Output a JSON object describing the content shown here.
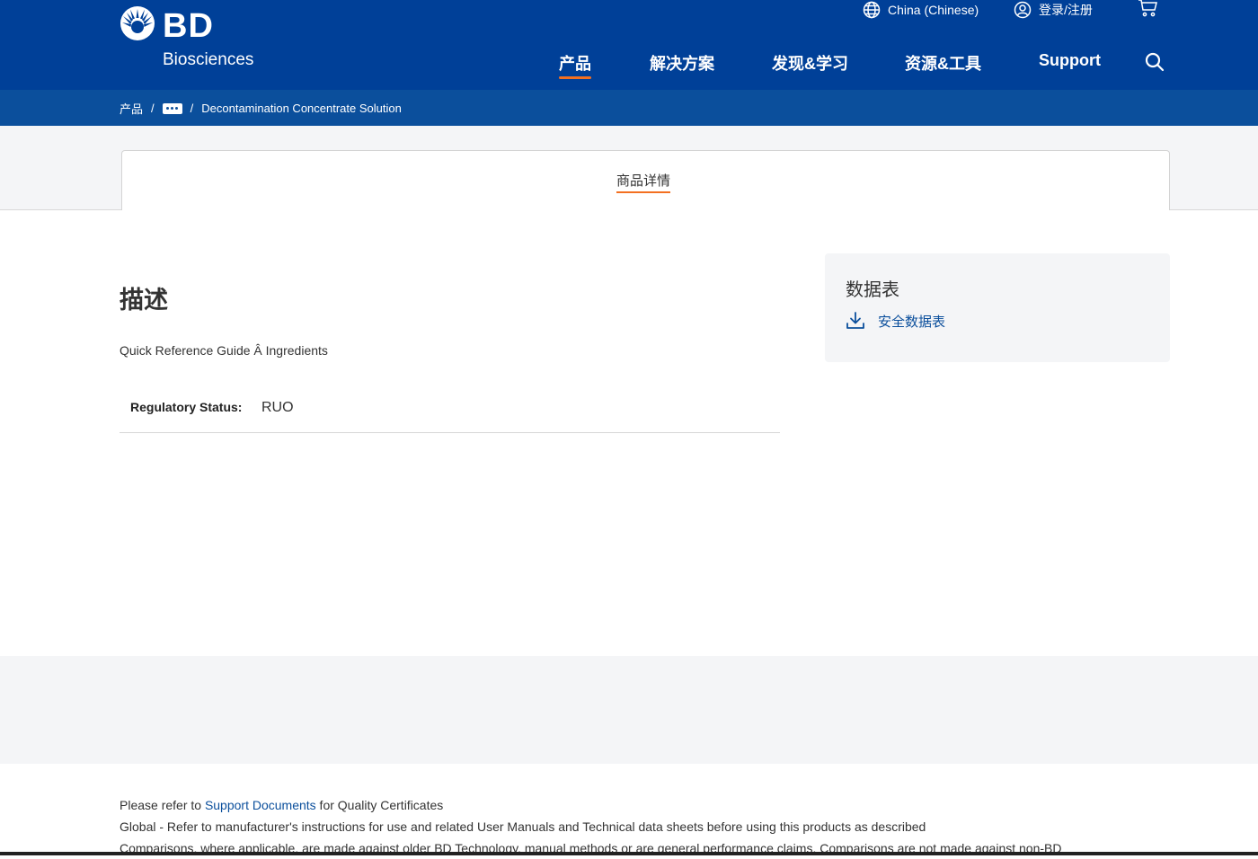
{
  "brand": {
    "name": "BD",
    "sub": "Biosciences"
  },
  "utility": {
    "region": "China (Chinese)",
    "login": "登录/注册"
  },
  "nav": {
    "items": [
      "产品",
      "解决方案",
      "发现&学习",
      "资源&工具",
      "Support"
    ]
  },
  "breadcrumb": {
    "root": "产品",
    "current": "Decontamination Concentrate Solution"
  },
  "tabs": {
    "active": "商品详情"
  },
  "description": {
    "title": "描述",
    "text": "Quick Reference Guide Â Ingredients",
    "regulatory_label": "Regulatory Status:",
    "regulatory_value": "RUO"
  },
  "datasheets": {
    "title": "数据表",
    "link": "安全数据表"
  },
  "footer": {
    "line1_pre": "Please refer to ",
    "line1_link": "Support Documents",
    "line1_post": " for Quality Certificates",
    "line2": "Global - Refer to manufacturer's instructions for use and related User Manuals and Technical data sheets before using this products as described",
    "line3": "Comparisons, where applicable, are made against older BD Technology, manual methods or are general performance claims.  Comparisons are not made against non-BD"
  },
  "colors": {
    "header": "#004098",
    "breadcrumb": "#0b4f9c",
    "accent": "#f37021",
    "link": "#0b4f9c"
  },
  "icons": [
    "bd-logo-icon",
    "globe-icon",
    "user-icon",
    "cart-icon",
    "search-icon",
    "more-icon",
    "download-icon"
  ]
}
